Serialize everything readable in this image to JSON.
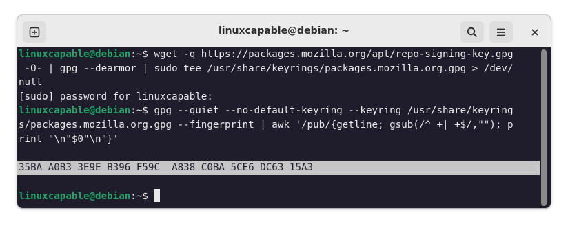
{
  "window": {
    "title": "linuxcapable@debian: ~"
  },
  "titlebar": {
    "new_tab_icon": "new-tab-icon",
    "search_icon": "search-icon",
    "menu_icon": "hamburger-menu-icon",
    "close_icon": "close-icon"
  },
  "terminal": {
    "prompt_user": "linuxcapable@debian",
    "prompt_sep": ":~$",
    "lines": [
      " wget -q https://packages.mozilla.org/apt/repo-signing-key.gpg",
      " -O- | gpg --dearmor | sudo tee /usr/share/keyrings/packages.mozilla.org.gpg > /dev/",
      "null",
      "[sudo] password for linuxcapable:",
      " gpg --quiet --no-default-keyring --keyring /usr/share/keyring",
      "s/packages.mozilla.org.gpg --fingerprint | awk '/pub/{getline; gsub(/^ +| +$/,\"\"); p",
      "rint \"\\n\"$0\"\\n\"}'",
      "",
      "35BA A0B3 3E9E B396 F59C  A838 C0BA 5CE6 DC63 15A3",
      "",
      " "
    ]
  }
}
